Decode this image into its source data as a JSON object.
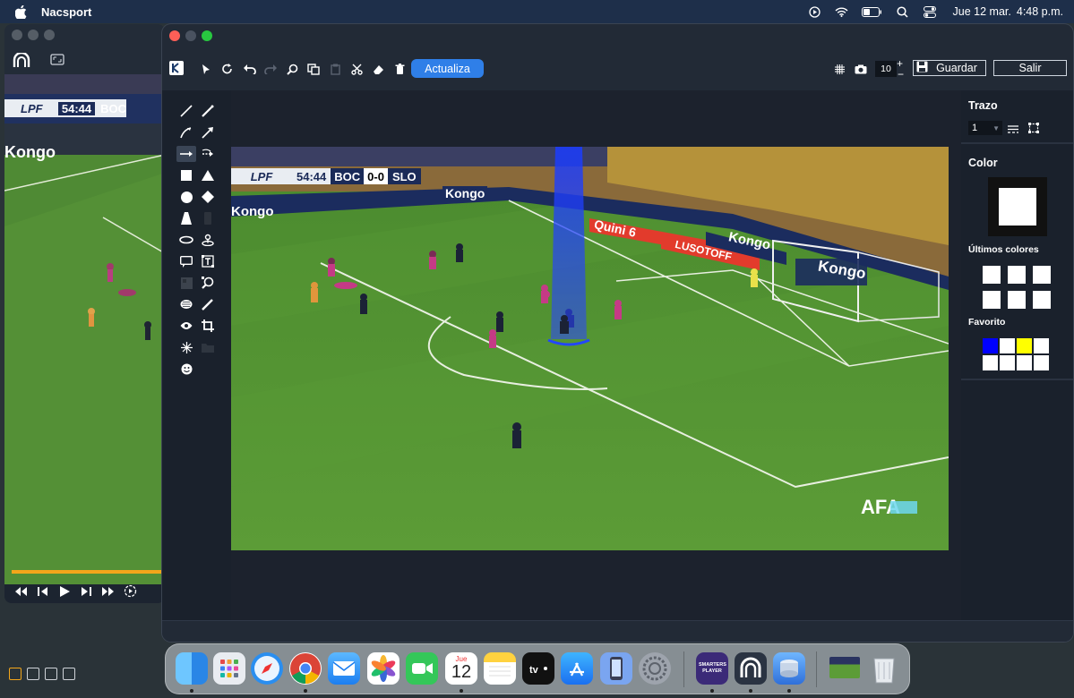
{
  "menubar": {
    "app_name": "Nacsport",
    "date": "Jue 12 mar.",
    "time": "4:48 p.m.",
    "icons": [
      "apple-icon",
      "play-circle-icon",
      "wifi-icon",
      "battery-icon",
      "search-icon",
      "control-center-icon"
    ]
  },
  "background_window": {
    "scoreboard_time": "54:44",
    "scoreboard_team": "BOC",
    "sponsor": "Kongo"
  },
  "toolbar": {
    "update_label": "Actualiza",
    "stroke_value": "10",
    "save_label": "Guardar",
    "exit_label": "Salir"
  },
  "video": {
    "scoreboard_league": "LPF",
    "scoreboard_time": "54:44",
    "home_team": "BOC",
    "score": "0-0",
    "away_team": "SLO",
    "sponsor_1": "Kongo",
    "sponsor_2": "Quini 6",
    "sponsor_3": "LUSOTOFF",
    "watermark": "AFA"
  },
  "right_panel": {
    "trazo_title": "Trazo",
    "trazo_value": "1",
    "color_title": "Color",
    "selected_color": "#ffffff",
    "recent_colors_title": "Últimos colores",
    "recent_colors": [
      "#ffffff",
      "#ffffff",
      "#ffffff",
      "#ffffff",
      "#ffffff",
      "#ffffff"
    ],
    "favorites_title": "Favorito",
    "favorites": [
      "#0000ff",
      "#ffffff",
      "#ffff00",
      "#ffffff",
      "#ffffff",
      "#ffffff",
      "#ffffff",
      "#ffffff"
    ]
  },
  "dock": {
    "calendar_month": "Jue",
    "calendar_day": "12",
    "streaming_label": "SMARTERS PLAYER",
    "apps": [
      "finder",
      "launchpad",
      "safari",
      "chrome",
      "mail",
      "photos",
      "facetime",
      "calendar",
      "notes",
      "apple-tv",
      "app-store",
      "simulator",
      "system-settings",
      "smarters-player",
      "nacsport",
      "disk-utility",
      "screenshot-thumbnail",
      "trash"
    ]
  }
}
